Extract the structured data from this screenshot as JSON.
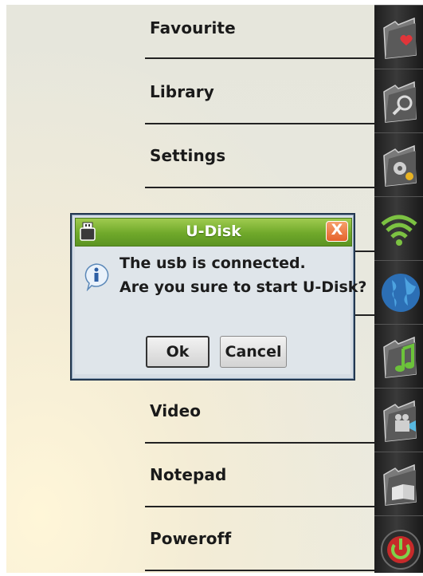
{
  "menu": {
    "items": [
      {
        "label": "Favourite"
      },
      {
        "label": "Library"
      },
      {
        "label": "Settings"
      },
      {
        "label": ""
      },
      {
        "label": ""
      },
      {
        "label": ""
      },
      {
        "label": "Video"
      },
      {
        "label": "Notepad"
      },
      {
        "label": "Poweroff"
      }
    ]
  },
  "sidebar": {
    "icons": [
      "folder-heart-icon",
      "folder-search-icon",
      "folder-settings-icon",
      "wifi-icon",
      "globe-icon",
      "folder-music-icon",
      "folder-video-icon",
      "folder-book-icon",
      "power-icon"
    ]
  },
  "dialog": {
    "title": "U-Disk",
    "close_label": "X",
    "line1": "The usb is connected.",
    "line2": "Are you sure to start U-Disk?",
    "ok_label": "Ok",
    "cancel_label": "Cancel"
  },
  "colors": {
    "title_bar": "#6fa82a",
    "dialog_bg": "#dfe5ea",
    "sidebar": "#2a2a2a"
  }
}
